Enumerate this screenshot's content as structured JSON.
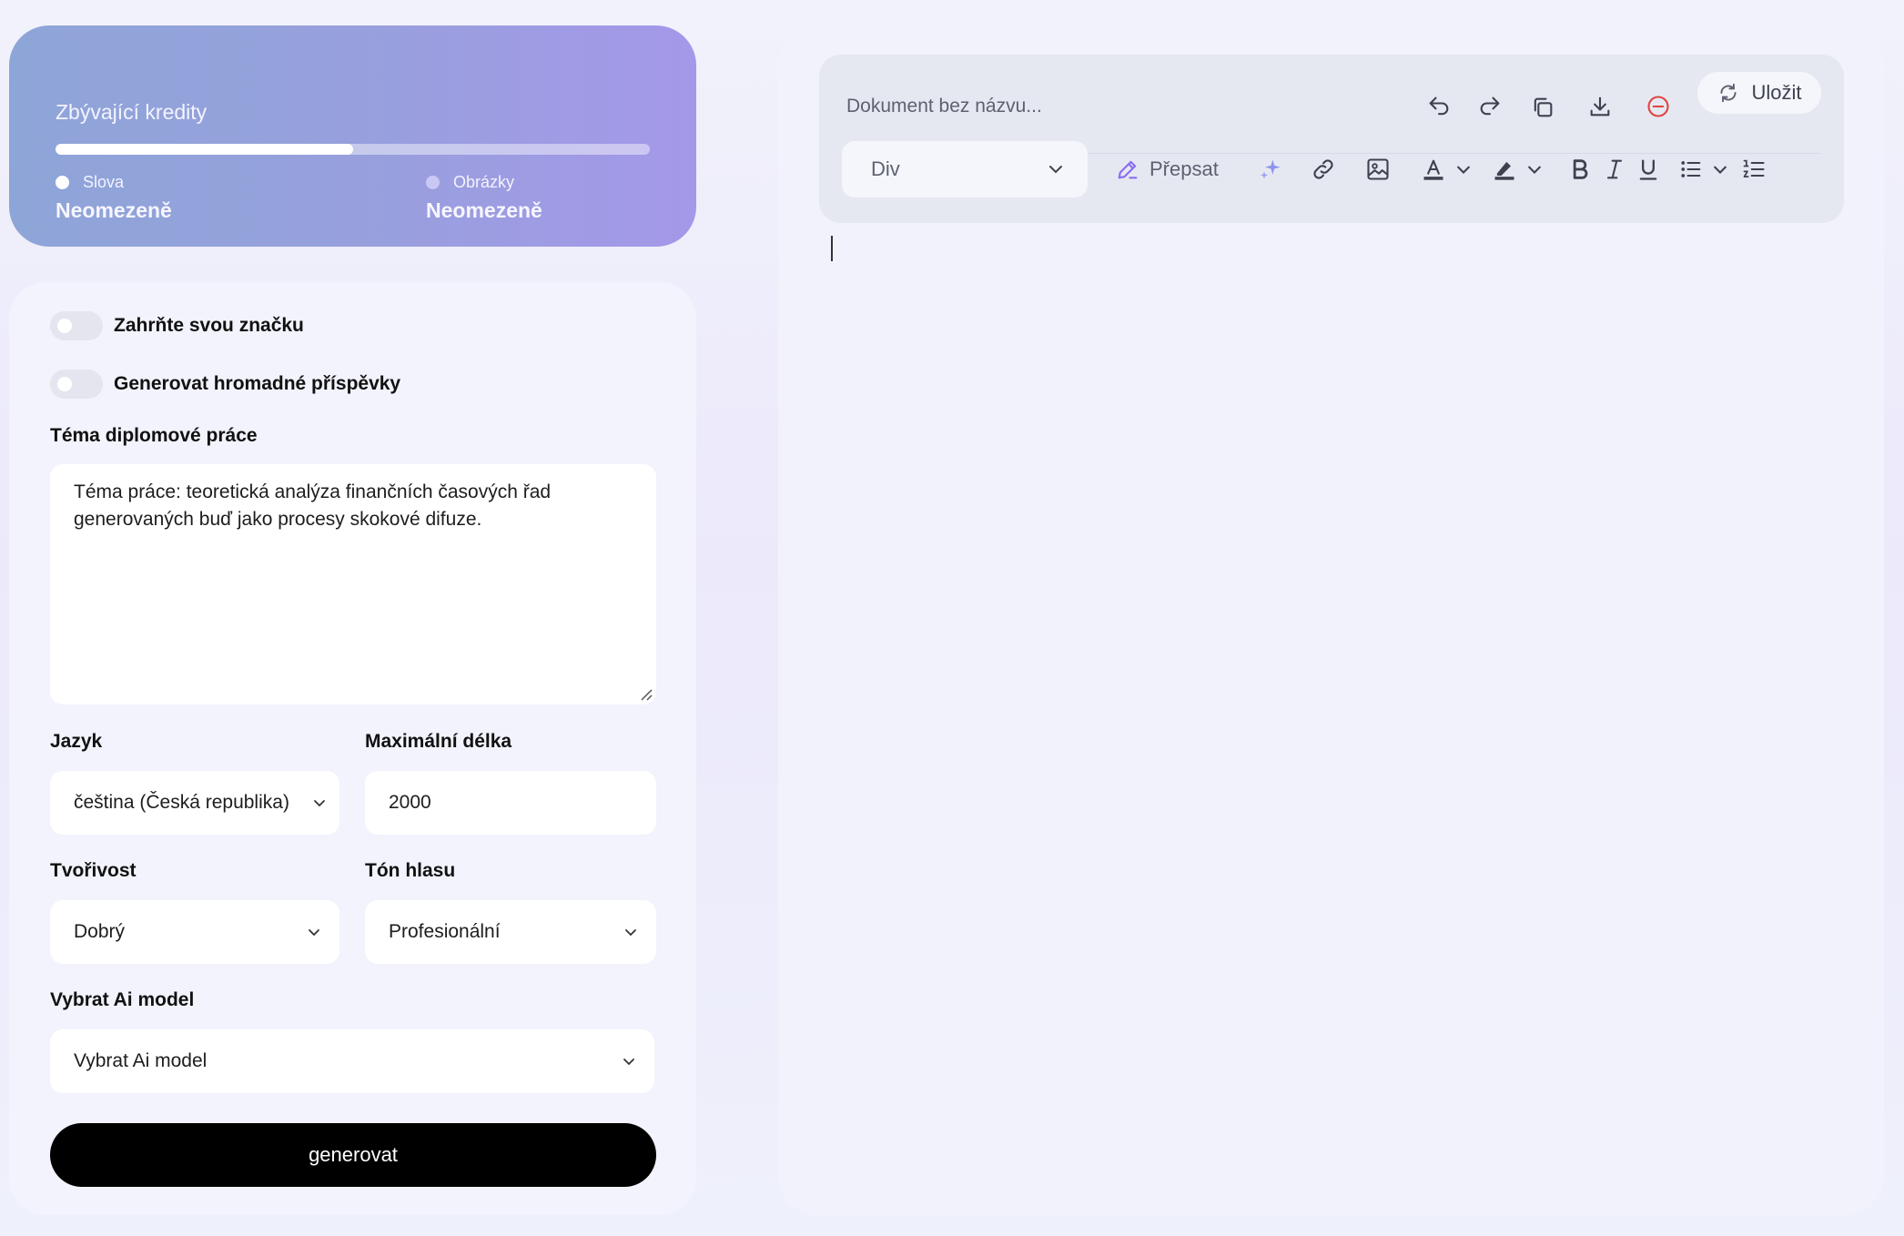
{
  "credits": {
    "title": "Zbývající kredity",
    "progress_fraction": 0.5,
    "words": {
      "label": "Slova",
      "value": "Neomezeně",
      "dot_color": "#ffffff"
    },
    "images": {
      "label": "Obrázky",
      "value": "Neomezeně",
      "dot_color": "#c9c8f5"
    }
  },
  "form": {
    "brand_toggle_label": "Zahrňte svou značku",
    "bulk_toggle_label": "Generovat hromadné příspěvky",
    "topic_label": "Téma diplomové práce",
    "topic_value": "Téma práce: teoretická analýza finančních časových řad generovaných buď jako procesy skokové difuze.",
    "language_label": "Jazyk",
    "language_value": "čeština (Česká republika)",
    "max_length_label": "Maximální délka",
    "max_length_value": "2000",
    "creativity_label": "Tvořivost",
    "creativity_value": "Dobrý",
    "tone_label": "Tón hlasu",
    "tone_value": "Profesionální",
    "ai_model_label": "Vybrat Ai model",
    "ai_model_value": "Vybrat Ai model",
    "generate_label": "generovat"
  },
  "editor": {
    "doc_placeholder": "Dokument bez názvu...",
    "save_label": "Uložit",
    "block_type": "Div",
    "rewrite_label": "Přepsat",
    "icons": [
      "undo-icon",
      "redo-icon",
      "copy-icon",
      "download-icon",
      "remove-icon",
      "refresh-icon",
      "pencil-icon",
      "sparkle-icon",
      "link-icon",
      "image-icon",
      "text-color-icon",
      "highlight-icon",
      "bold-icon",
      "italic-icon",
      "underline-icon",
      "bullet-list-icon",
      "numbered-list-icon"
    ],
    "accent_color": "#8a6cf0",
    "danger_color": "#e0443e"
  }
}
